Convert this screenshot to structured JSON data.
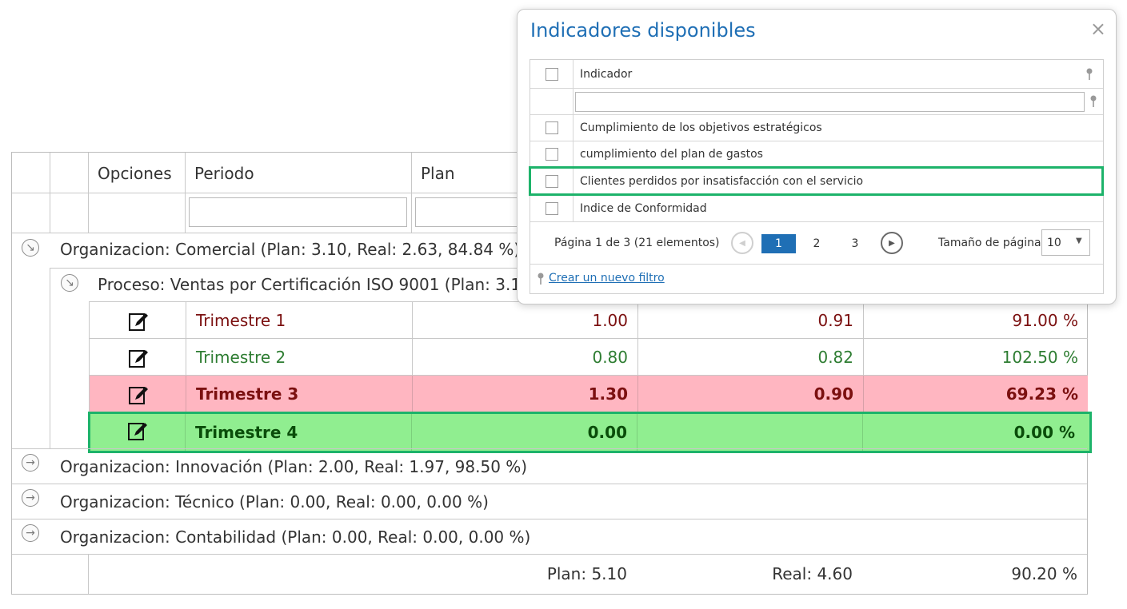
{
  "grid": {
    "headers": {
      "options": "Opciones",
      "period": "Periodo",
      "plan": "Plan"
    },
    "groups": [
      {
        "text": "Organizacion: Comercial (Plan: 3.10, Real: 2.63, 84.84 %)"
      },
      {
        "text": "Organizacion: Innovación (Plan: 2.00, Real: 1.97, 98.50 %)"
      },
      {
        "text": "Organizacion: Técnico (Plan: 0.00, Real: 0.00, 0.00 %)"
      },
      {
        "text": "Organizacion: Contabilidad (Plan: 0.00, Real: 0.00, 0.00 %)"
      }
    ],
    "subgroup": {
      "text": "Proceso: Ventas por Certificación ISO 9001 (Plan: 3.10,"
    },
    "rows": [
      {
        "period": "Trimestre 1",
        "plan": "1.00",
        "real": "0.91",
        "pct": "91.00 %"
      },
      {
        "period": "Trimestre 2",
        "plan": "0.80",
        "real": "0.82",
        "pct": "102.50 %"
      },
      {
        "period": "Trimestre 3",
        "plan": "1.30",
        "real": "0.90",
        "pct": "69.23 %"
      },
      {
        "period": "Trimestre 4",
        "plan": "0.00",
        "real": "",
        "pct": "0.00 %"
      }
    ],
    "footer": {
      "plan": "Plan: 5.10",
      "real": "Real: 4.60",
      "pct": "90.20 %"
    },
    "colors": {
      "row3_bg": "#ffb6c1",
      "row4_bg": "#90ee90",
      "highlight": "#1db36a"
    }
  },
  "popup": {
    "title": "Indicadores disponibles",
    "close": "×",
    "column_header": "Indicador",
    "items": [
      "Cumplimiento de los objetivos estratégicos",
      "cumplimiento del plan de gastos",
      "Clientes perdidos por insatisfacción con el servicio",
      "Indice de Conformidad"
    ],
    "pager": {
      "info": "Página 1 de 3 (21 elementos)",
      "pages": [
        "1",
        "2",
        "3"
      ],
      "current_page": "1",
      "page_size_label": "Tamaño de página:",
      "page_size": "10"
    },
    "new_filter_link": "Crear un nuevo filtro"
  }
}
